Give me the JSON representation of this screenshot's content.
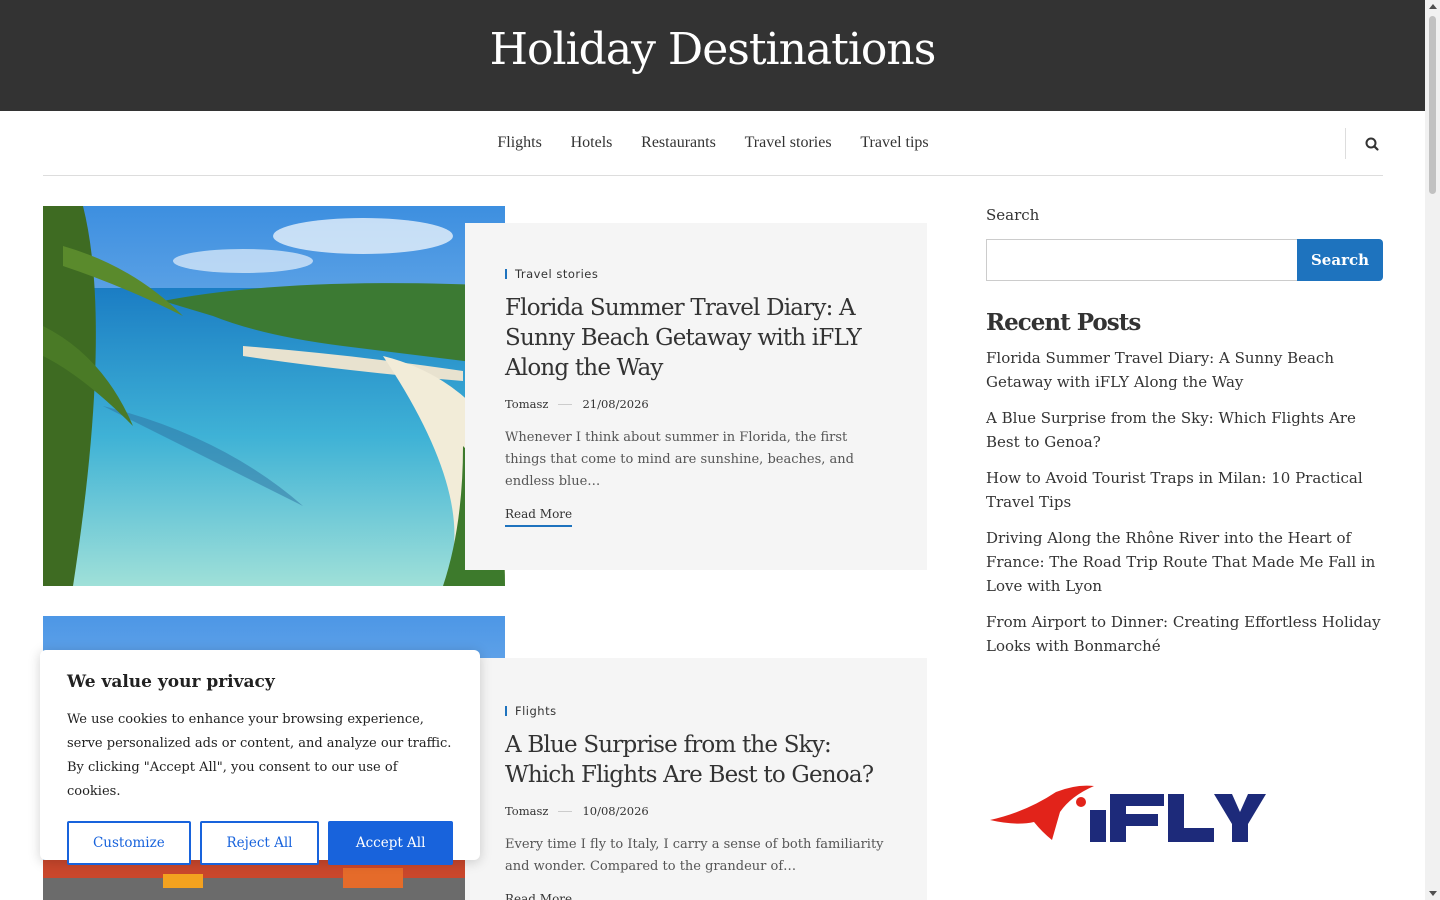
{
  "site": {
    "title": "Holiday Destinations"
  },
  "nav": {
    "items": [
      "Flights",
      "Hotels",
      "Restaurants",
      "Travel stories",
      "Travel tips"
    ]
  },
  "posts": [
    {
      "category": "Travel stories",
      "title": "Florida Summer Travel Diary: A Sunny Beach Getaway with iFLY Along the Way",
      "author": "Tomasz",
      "date": "21/08/2026",
      "excerpt": "Whenever I think about summer in Florida, the first things that come to mind are sunshine, beaches, and endless blue…",
      "read_more": "Read More"
    },
    {
      "category": "Flights",
      "title": "A Blue Surprise from the Sky: Which Flights Are Best to Genoa?",
      "author": "Tomasz",
      "date": "10/08/2026",
      "excerpt": "Every time I fly to Italy, I carry a sense of both familiarity and wonder. Compared to the grandeur of…",
      "read_more": "Read More"
    }
  ],
  "sidebar": {
    "search_label": "Search",
    "search_button": "Search",
    "recent_title": "Recent Posts",
    "recent_posts": [
      "Florida Summer Travel Diary: A Sunny Beach Getaway with iFLY Along the Way",
      "A Blue Surprise from the Sky: Which Flights Are Best to Genoa?",
      "How to Avoid Tourist Traps in Milan: 10 Practical Travel Tips",
      "Driving Along the Rhône River into the Heart of France: The Road Trip Route That Made Me Fall in Love with Lyon",
      "From Airport to Dinner: Creating Effortless Holiday Looks with Bonmarché"
    ],
    "ad_logo_text": "iFLY"
  },
  "cookie": {
    "title": "We value your privacy",
    "text": "We use cookies to enhance your browsing experience, serve personalized ads or content, and analyze our traffic. By clicking \"Accept All\", you consent to our use of cookies.",
    "customize": "Customize",
    "reject": "Reject All",
    "accept": "Accept All"
  },
  "colors": {
    "header_bg": "#333333",
    "accent": "#1e73be",
    "cookie_accent": "#1863dc",
    "ifly_red": "#e2231a",
    "ifly_blue": "#1d2a7a"
  }
}
